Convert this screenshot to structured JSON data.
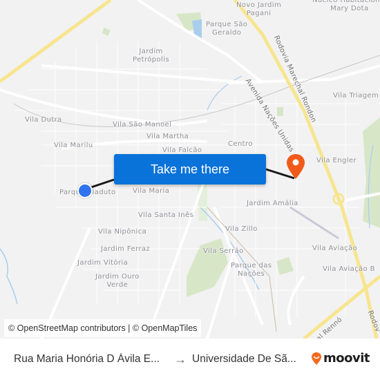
{
  "map": {
    "colors": {
      "background": "#f2f2f2",
      "road": "#ffffff",
      "highway": "#f7e58f",
      "park": "#d8e6c8",
      "water": "#a9cdec",
      "route": "#1a1a1a",
      "origin": "#2f74ee",
      "destination": "#f05a1a"
    },
    "labels": {
      "novo_jardim_pagani": [
        "Novo Jardim",
        "Pagani"
      ],
      "nucleo_mary_dota": [
        "Núcleo Habitacional",
        "Mary Dota"
      ],
      "parque_sao_geraldo": [
        "Parque São",
        "Geraldo"
      ],
      "jardim_petropolis": [
        "Jardim",
        "Petrópolis"
      ],
      "vila_triagem": "Vila Triagem",
      "vila_dutra": "Vila Dutra",
      "vila_sao_manoel": "Vila São Manoel",
      "vila_martha": "Vila Martha",
      "vila_marilu": "Vila Marilu",
      "vila_falcao": "Vila Falcão",
      "centro": "Centro",
      "vila_engler": "Vila Engler",
      "parque_viaduto": "Parque Viaduto",
      "vila_maria": "Vila Maria",
      "jardim_amalia": "Jardim Amália",
      "vila_santa_ines": "Vila Santa Inês",
      "vila_niponica": "Vila Nipônica",
      "vila_zillo": "Vila Zillo",
      "jardim_ferraz": "Jardim Ferraz",
      "vila_serrao": "Vila Serrão",
      "vila_aviacao": "Vila Aviação",
      "jardim_vitoria": "Jardim Vitória",
      "parque_das_nacoes": [
        "Parque das",
        "Nações"
      ],
      "vila_aviacao_b": "Vila Aviação B",
      "jardim_ouro_verde": [
        "Jardim Ouro",
        "Verde"
      ]
    },
    "road_labels": {
      "rodovia_marechal_rondon": "Rodovia Marechal Rondon",
      "avenida_nacoes_unidas": "Avenida Nações Unidas",
      "marechal_renno": "al Rennó",
      "rodovia_se": "Rodov"
    },
    "cta_label": "Take me there",
    "attribution": "© OpenStreetMap contributors | © OpenMapTiles"
  },
  "footer": {
    "from": "Rua Maria Honória D Ávila E...",
    "arrow": "→",
    "to": "Universidade De Sã...",
    "brand": "moovit",
    "brand_color": "#f26a21"
  }
}
